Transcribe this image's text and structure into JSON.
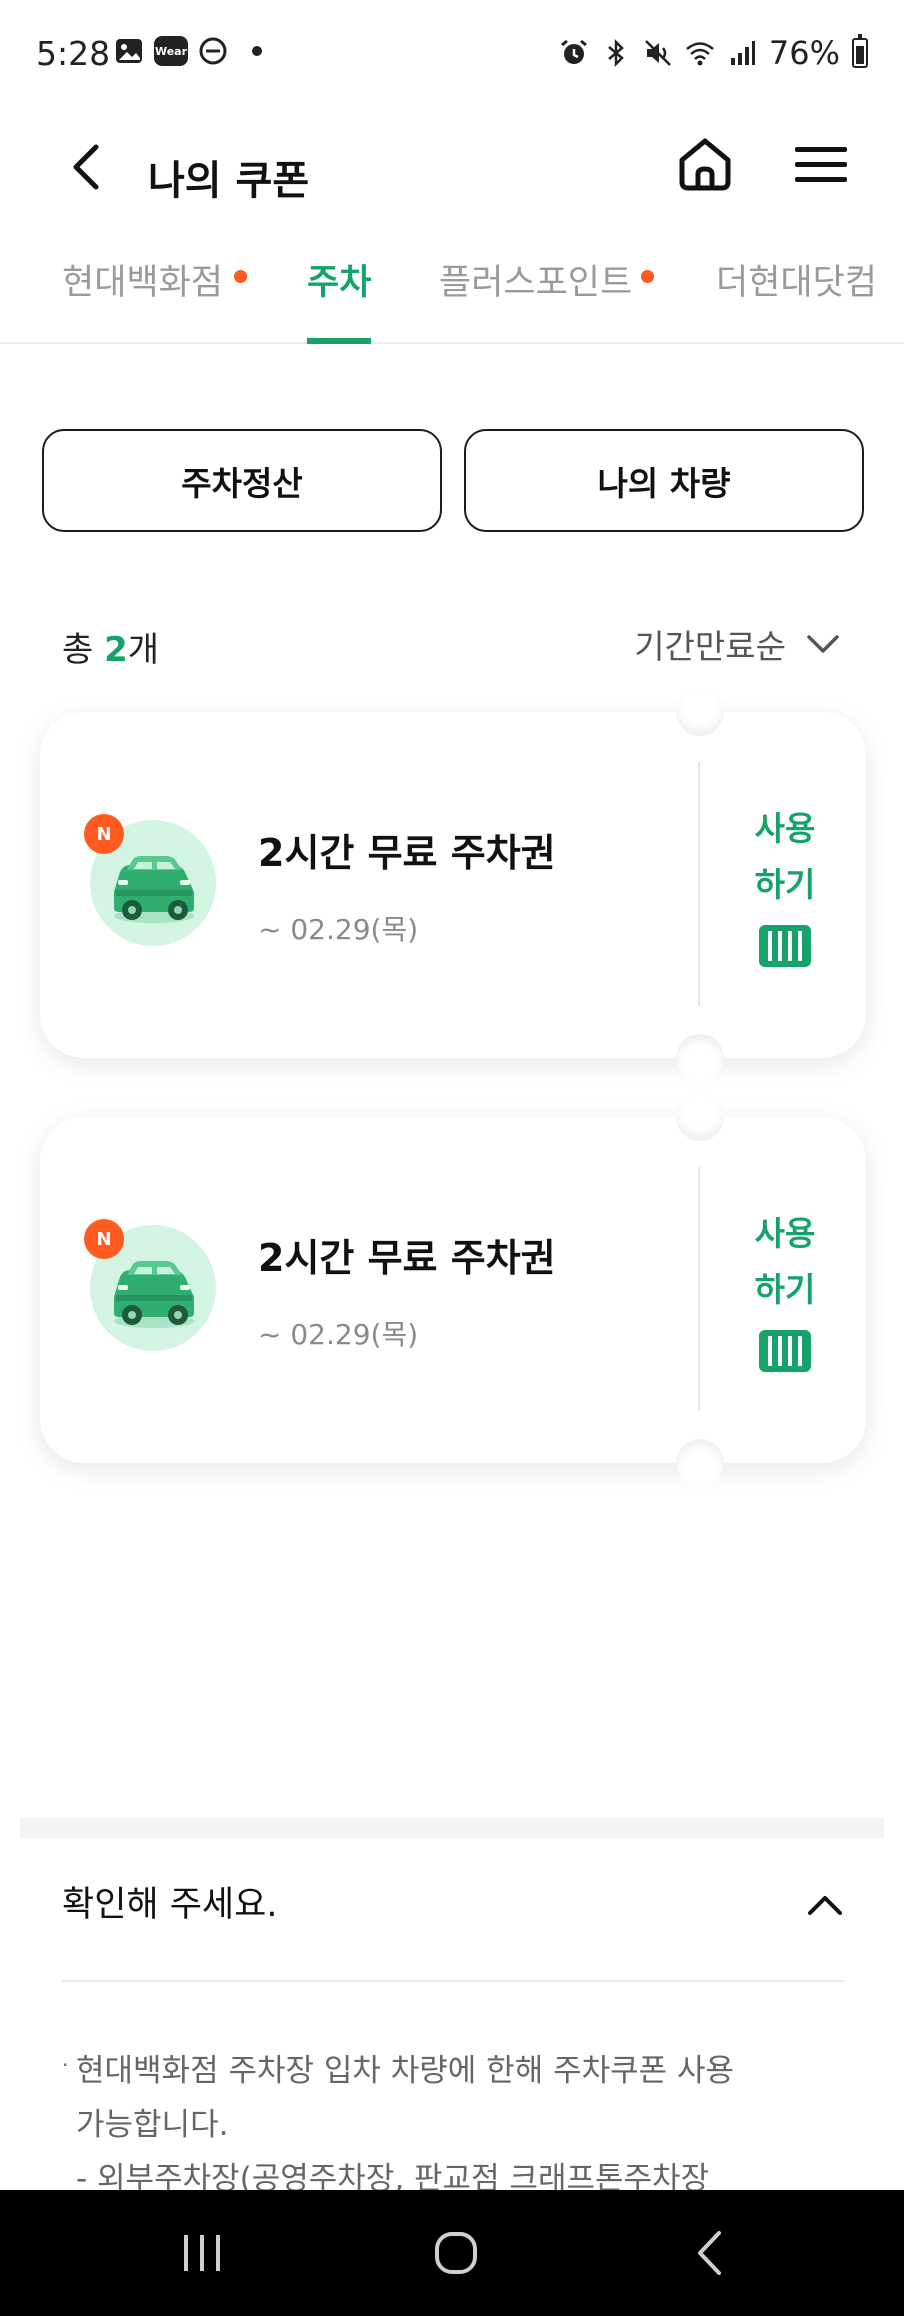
{
  "status_bar": {
    "time": "5:28",
    "wear_label": "Wear",
    "battery": "76%",
    "icons": [
      "image-icon",
      "wear-icon",
      "dnd-icon",
      "alarm-icon",
      "bluetooth-icon",
      "mute-icon",
      "wifi-icon",
      "signal-icon",
      "battery-icon"
    ]
  },
  "header": {
    "title": "나의 쿠폰",
    "back_icon": "back-arrow-icon",
    "home_icon": "home-icon",
    "menu_icon": "menu-icon"
  },
  "tabs": [
    {
      "label": "현대백화점",
      "active": false,
      "has_dot": true
    },
    {
      "label": "주차",
      "active": true,
      "has_dot": false
    },
    {
      "label": "플러스포인트",
      "active": false,
      "has_dot": true
    },
    {
      "label": "더현대닷컴",
      "active": false,
      "has_dot": false
    }
  ],
  "actions": {
    "parking_payment": "주차정산",
    "my_vehicle": "나의 차량"
  },
  "list": {
    "total_prefix": "총 ",
    "total_count": "2",
    "total_suffix": "개",
    "sort_label": "기간만료순"
  },
  "coupons": [
    {
      "badge": "N",
      "title": "2시간 무료 주차권",
      "date": "~ 02.29(목)",
      "use_label_1": "사용",
      "use_label_2": "하기"
    },
    {
      "badge": "N",
      "title": "2시간 무료 주차권",
      "date": "~ 02.29(목)",
      "use_label_1": "사용",
      "use_label_2": "하기"
    }
  ],
  "notice": {
    "heading": "확인해 주세요.",
    "bullet": "·",
    "line_1": "현대백화점 주차장 입차 차량에 한해 주차쿠폰 사용",
    "line_2": "가능합니다.",
    "line_3": "- 외부주차장(공영주차장, 판교점 크래프톤주차장"
  },
  "colors": {
    "accent": "#16a36a",
    "badge": "#ff5a1f",
    "car_circle": "#d3f3e3"
  }
}
